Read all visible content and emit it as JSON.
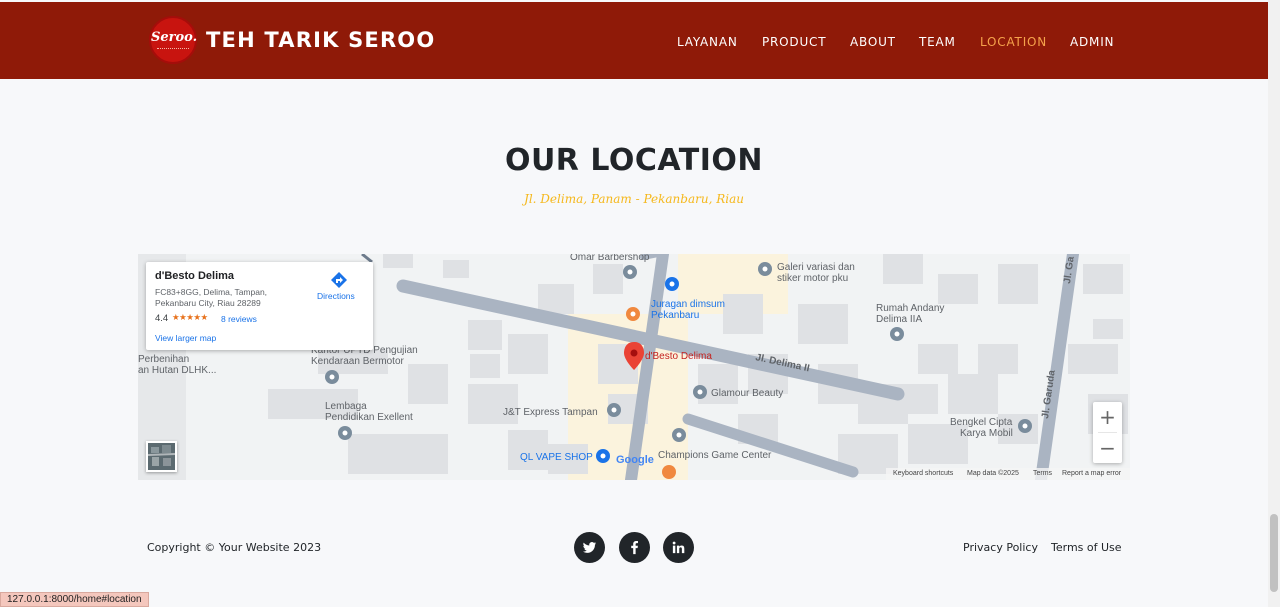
{
  "header": {
    "logo_text": "Seroo.",
    "brand": "TEH TARIK SEROO",
    "nav": [
      {
        "label": "LAYANAN",
        "active": false
      },
      {
        "label": "PRODUCT",
        "active": false
      },
      {
        "label": "ABOUT",
        "active": false
      },
      {
        "label": "TEAM",
        "active": false
      },
      {
        "label": "LOCATION",
        "active": true
      },
      {
        "label": "ADMIN",
        "active": false
      }
    ],
    "background": "#8f1a08",
    "active_color": "#f5a24b"
  },
  "location": {
    "title": "OUR LOCATION",
    "address": "Jl. Delima, Panam - Pekanbaru, Riau",
    "accent": "#f5b81c"
  },
  "map": {
    "info_card": {
      "name": "d'Besto Delima",
      "address": "FC83+8GG, Delima, Tampan, Pekanbaru City, Riau 28289",
      "rating": "4.4",
      "stars": "★★★★★",
      "reviews": "8 reviews",
      "view_larger": "View larger map",
      "directions": "Directions"
    },
    "labels": {
      "barbershop": "Omar Barbershop",
      "galeri_1": "Galeri variasi dan",
      "galeri_2": "stiker motor pku",
      "juragan_1": "Juragan dimsum",
      "juragan_2": "Pekanbaru",
      "rumah_1": "Rumah Andany",
      "rumah_2": "Delima IIA",
      "jl_garuda": "Jl. Garuda",
      "jl_garuda_top": "Jl. Ga",
      "kantor_1": "Kantor UPTD Pengujian",
      "kantor_2": "Kendaraan Bermotor",
      "perbenihan_1": "Perbenihan",
      "perbenihan_2": "an Hutan DLHK...",
      "marker": "d'Besto Delima",
      "jl_delima": "Jl. Delima II",
      "glamour": "Glamour Beauty",
      "lembaga_1": "Lembaga",
      "lembaga_2": "Pendidikan Exellent",
      "jt": "J&T Express Tampan",
      "bengkel_1": "Bengkel Cipta",
      "bengkel_2": "Karya Mobil",
      "champions": "Champions Game Center",
      "qlvape": "QL VAPE SHOP"
    },
    "zoom_in": "+",
    "zoom_out": "−",
    "google": "Google",
    "attribution": {
      "shortcuts": "Keyboard shortcuts",
      "map_data": "Map data ©2025",
      "terms": "Terms",
      "report": "Report a map error"
    }
  },
  "footer": {
    "copyright": "Copyright © Your Website 2023",
    "social": [
      "twitter-icon",
      "facebook-icon",
      "linkedin-icon"
    ],
    "privacy": "Privacy Policy",
    "terms": "Terms of Use"
  },
  "status_bar": {
    "url": "127.0.0.1:8000/home#location"
  }
}
